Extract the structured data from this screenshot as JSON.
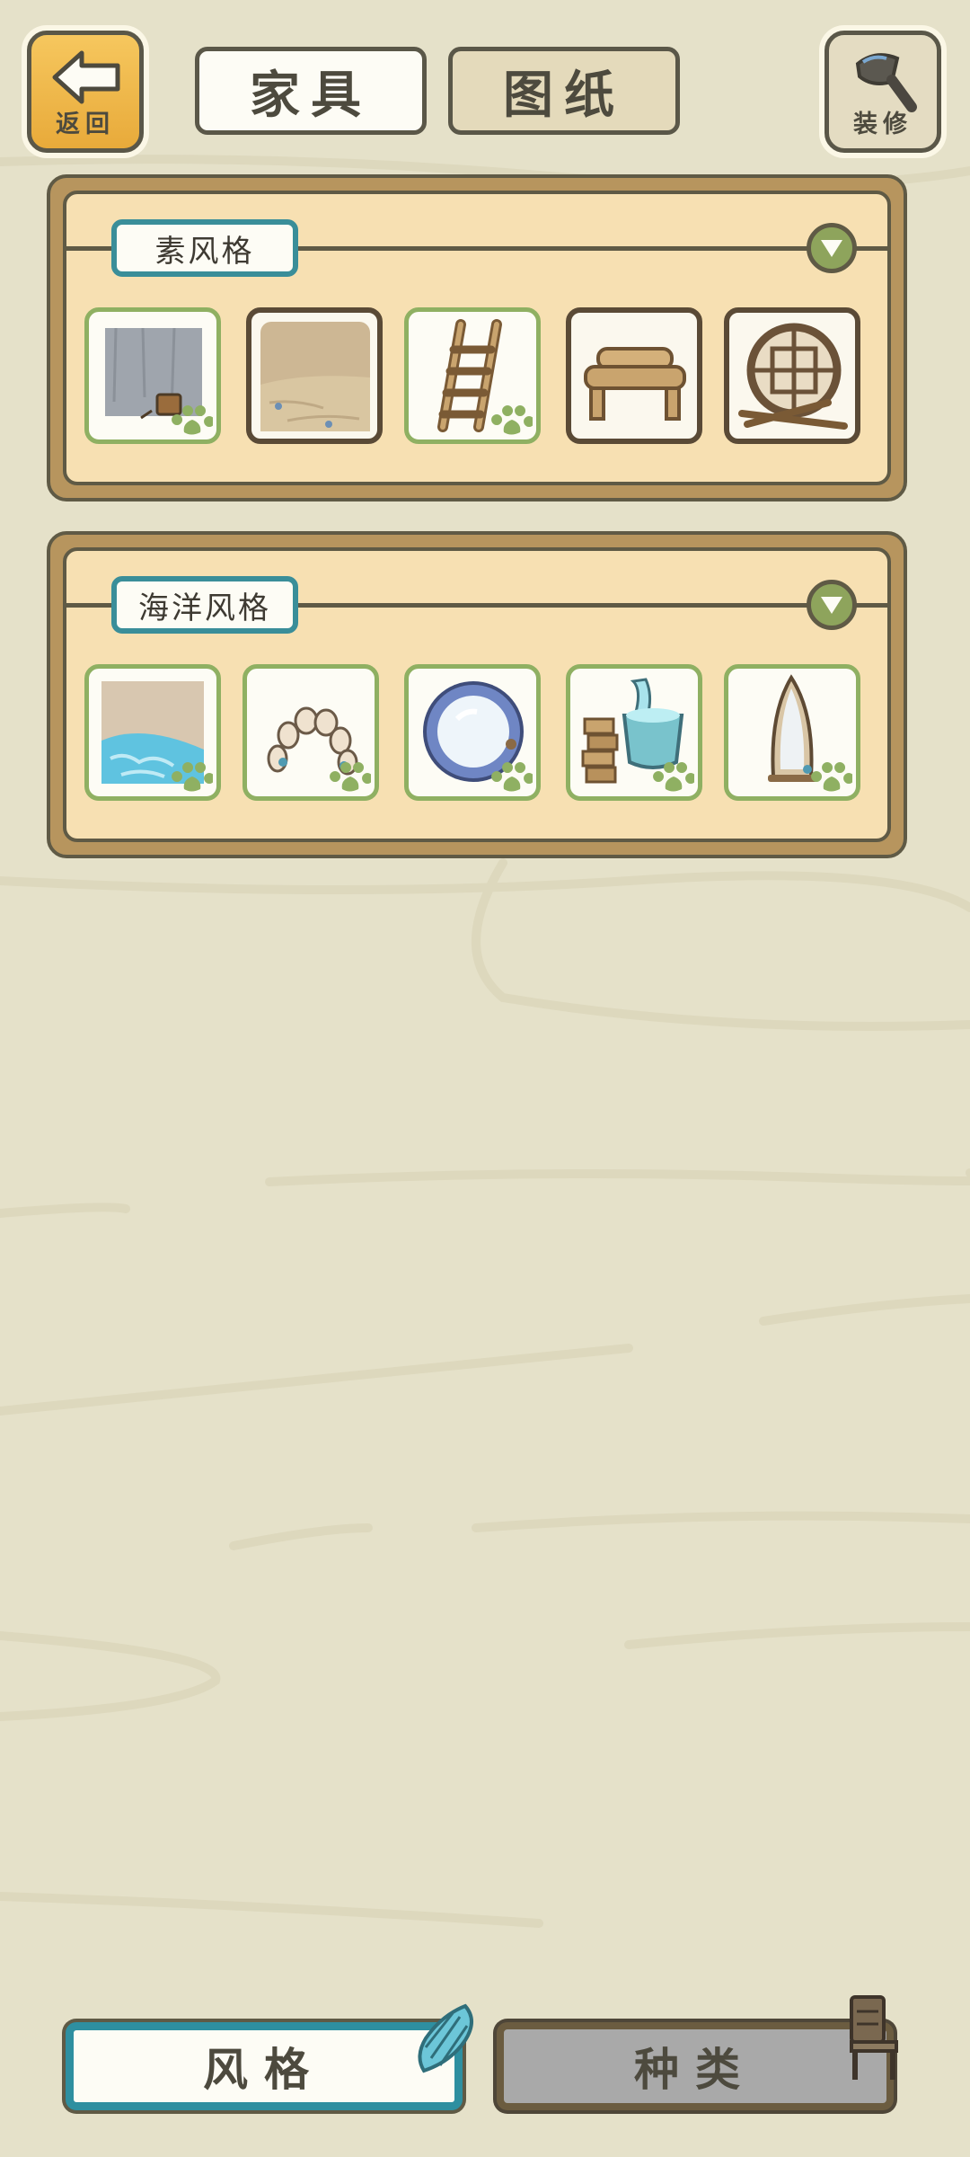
{
  "header": {
    "back_label": "返回",
    "tabs": [
      {
        "label": "家具",
        "selected": true
      },
      {
        "label": "图纸",
        "selected": false
      }
    ],
    "decorate_label": "装修"
  },
  "sections": [
    {
      "title": "素风格",
      "items": [
        {
          "name": "grey-wall-with-bucket",
          "owned": true
        },
        {
          "name": "sandy-floor",
          "owned": false
        },
        {
          "name": "wooden-ladder",
          "owned": true
        },
        {
          "name": "log-bench",
          "owned": false
        },
        {
          "name": "round-lattice-window",
          "owned": false
        }
      ]
    },
    {
      "title": "海洋风格",
      "items": [
        {
          "name": "pool-floor",
          "owned": true
        },
        {
          "name": "stone-arch",
          "owned": true
        },
        {
          "name": "round-porthole-mirror",
          "owned": true
        },
        {
          "name": "wooden-tub-with-logs",
          "owned": true
        },
        {
          "name": "surfboard-mirror",
          "owned": true
        }
      ]
    }
  ],
  "bottom_tabs": [
    {
      "label": "风格",
      "selected": true
    },
    {
      "label": "种类",
      "selected": false
    }
  ],
  "colors": {
    "background": "#e5e1c9",
    "accent_teal": "#2e8fa0",
    "owned_border": "#8fb062",
    "panel_fill": "#f7e0b2"
  }
}
